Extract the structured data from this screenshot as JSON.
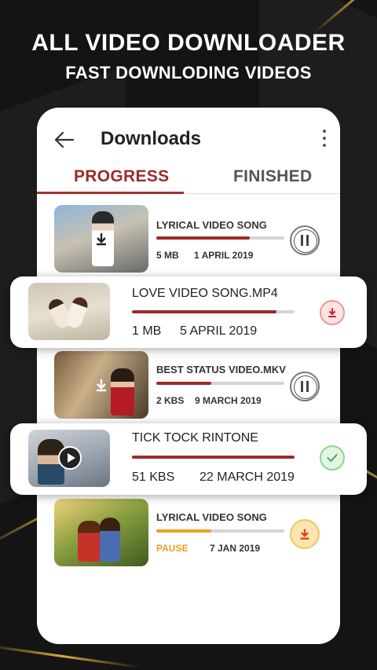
{
  "promo": {
    "title": "ALL VIDEO DOWNLOADER",
    "subtitle": "FAST DOWNLODING VIDEOS"
  },
  "appbar": {
    "title": "Downloads"
  },
  "tabs": [
    {
      "label": "PROGRESS",
      "active": true
    },
    {
      "label": "FINISHED",
      "active": false
    }
  ],
  "downloads": [
    {
      "name": "LYRICAL VIDEO SONG",
      "size": "5 MB",
      "date": "1 APRIL 2019",
      "progress": 0.73,
      "status": "pause"
    },
    {
      "name": "LOVE VIDEO SONG.MP4",
      "size": "1 MB",
      "date": "5 APRIL 2019",
      "progress": 0.89,
      "status": "download"
    },
    {
      "name": "BEST STATUS VIDEO.MKV",
      "size": "2 KBS",
      "date": "9 MARCH 2019",
      "progress": 0.43,
      "status": "pause"
    },
    {
      "name": "TICK TOCK RINTONE",
      "size": "51 KBS",
      "date": "22 MARCH 2019",
      "progress": 1.0,
      "status": "finished"
    },
    {
      "name": "LYRICAL VIDEO SONG",
      "size": "PAUSE",
      "date": "7 JAN 2019",
      "progress": 0.43,
      "status": "paused-download"
    }
  ],
  "colors": {
    "accent": "#9e2a2a",
    "check": "#3aa84a",
    "pause_text": "#e9a020"
  }
}
